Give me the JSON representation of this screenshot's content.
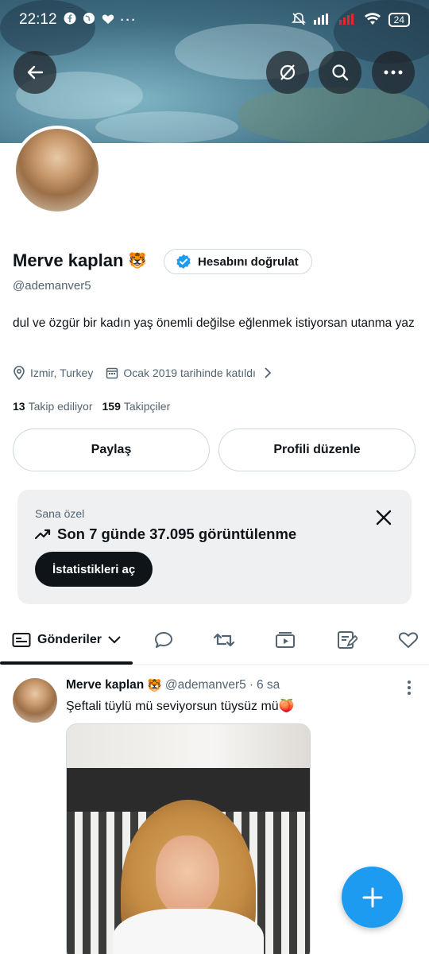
{
  "status_bar": {
    "time": "22:12",
    "battery": "24"
  },
  "profile": {
    "name": "Merve kaplan",
    "name_emoji": "🐯",
    "verify_label": "Hesabını doğrulat",
    "handle": "@ademanver5",
    "bio": "dul ve özgür bir kadın yaş önemli değilse eğlenmek istiyorsan utanma yaz",
    "location": "Izmir, Turkey",
    "joined": "Ocak 2019 tarihinde katıldı",
    "following_count": "13",
    "following_label": "Takip ediliyor",
    "followers_count": "159",
    "followers_label": "Takipçiler"
  },
  "actions": {
    "share_label": "Paylaş",
    "edit_label": "Profili düzenle"
  },
  "insight_card": {
    "kicker": "Sana özel",
    "headline": "Son 7 günde 37.095 görüntülenme",
    "button_label": "İstatistikleri aç"
  },
  "tabs": {
    "active_label": "Gönderiler",
    "icons": [
      "chat-bubble-icon",
      "repost-icon",
      "video-icon",
      "article-icon",
      "heart-icon"
    ]
  },
  "post": {
    "author": "Merve kaplan",
    "author_emoji": "🐯",
    "handle": "@ademanver5",
    "separator": "·",
    "time": "6 sa",
    "text": "Şeftali tüylü mü seviyorsun tüysüz mü🍑"
  },
  "colors": {
    "accent": "#1d9bf0",
    "text_primary": "#0f1419",
    "text_secondary": "#536471",
    "border": "#cfd9de"
  }
}
